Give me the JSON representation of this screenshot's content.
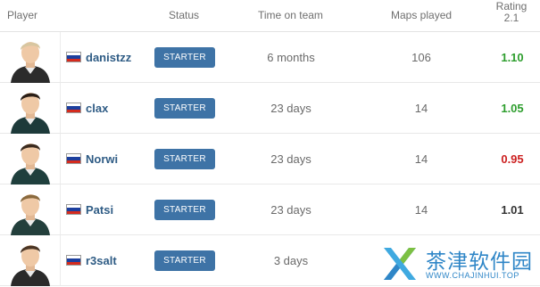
{
  "header": {
    "player": "Player",
    "status": "Status",
    "time_on_team": "Time on team",
    "maps_played": "Maps played",
    "rating_line1": "Rating",
    "rating_line2": "2.1"
  },
  "players": [
    {
      "nick": "danistzz",
      "country": "russia-flag-icon",
      "status": "STARTER",
      "time": "6 months",
      "maps": "106",
      "rating": "1.10",
      "rating_color": "#2e9e2e"
    },
    {
      "nick": "clax",
      "country": "russia-flag-icon",
      "status": "STARTER",
      "time": "23 days",
      "maps": "14",
      "rating": "1.05",
      "rating_color": "#2e9e2e"
    },
    {
      "nick": "Norwi",
      "country": "russia-flag-icon",
      "status": "STARTER",
      "time": "23 days",
      "maps": "14",
      "rating": "0.95",
      "rating_color": "#cc2020"
    },
    {
      "nick": "Patsi",
      "country": "russia-flag-icon",
      "status": "STARTER",
      "time": "23 days",
      "maps": "14",
      "rating": "1.01",
      "rating_color": "#333333"
    },
    {
      "nick": "r3salt",
      "country": "russia-flag-icon",
      "status": "STARTER",
      "time": "3 days",
      "maps": "",
      "rating": "",
      "rating_color": "#333333"
    }
  ],
  "watermark": {
    "name": "茶津软件园",
    "url": "WWW.CHAJINHUI.TOP"
  }
}
